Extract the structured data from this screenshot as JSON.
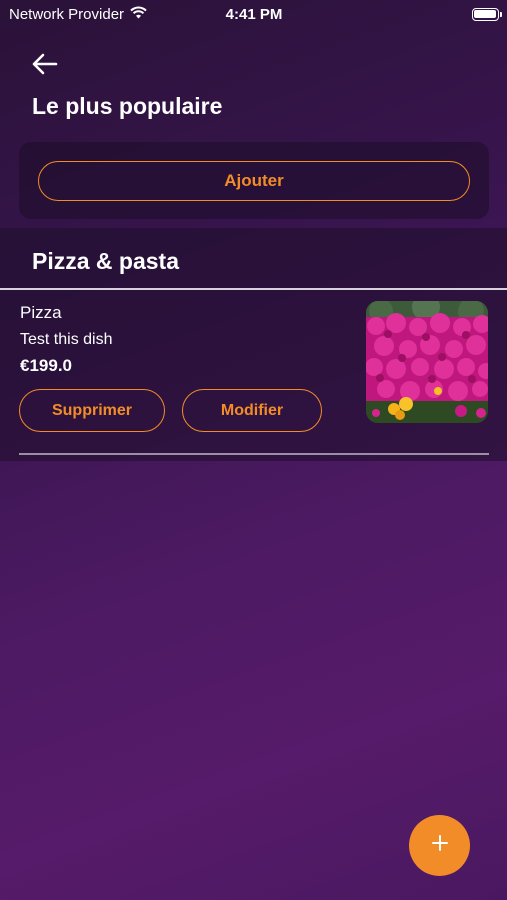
{
  "status_bar": {
    "carrier": "Network Provider",
    "time": "4:41 PM"
  },
  "header": {
    "title": "Le plus populaire"
  },
  "add_card": {
    "button_label": "Ajouter"
  },
  "section": {
    "title": "Pizza & pasta",
    "items": [
      {
        "name": "Pizza",
        "description": "Test this dish",
        "price": "€199.0",
        "delete_label": "Supprimer",
        "edit_label": "Modifier",
        "image_icon": "flower-photo"
      }
    ]
  },
  "fab": {
    "icon": "plus-icon"
  },
  "colors": {
    "accent": "#f28c28",
    "background": "#4d1a63"
  }
}
